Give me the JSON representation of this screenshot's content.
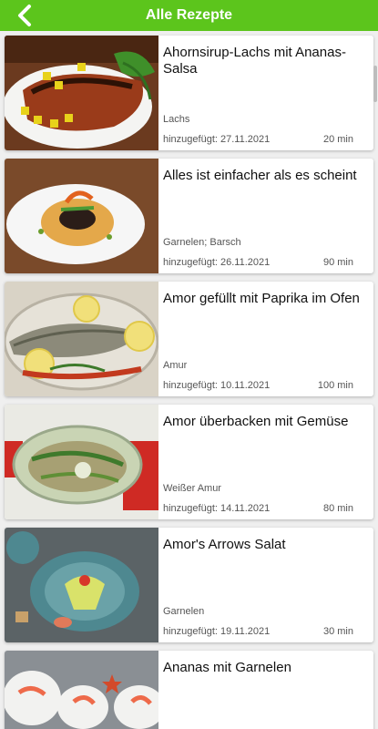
{
  "header": {
    "title": "Alle Rezepte",
    "back_icon": "chevron-left-icon",
    "color": "#5cc51c"
  },
  "recipes": [
    {
      "name": "Ahornsirup-Lachs mit Ananas-Salsa",
      "category": "Lachs",
      "added": "hinzugefügt: 27.11.2021",
      "time": "20 min"
    },
    {
      "name": "Alles ist einfacher als es scheint",
      "category": "Garnelen; Barsch",
      "added": "hinzugefügt: 26.11.2021",
      "time": "90 min"
    },
    {
      "name": "Amor gefüllt mit Paprika im Ofen",
      "category": "Amur",
      "added": "hinzugefügt: 10.11.2021",
      "time": "100 min"
    },
    {
      "name": "Amor überbacken mit Gemüse",
      "category": "Weißer Amur",
      "added": "hinzugefügt: 14.11.2021",
      "time": "80 min"
    },
    {
      "name": "Amor's Arrows Salat",
      "category": "Garnelen",
      "added": "hinzugefügt: 19.11.2021",
      "time": "30 min"
    },
    {
      "name": "Ananas mit Garnelen",
      "category": "",
      "added": "",
      "time": ""
    }
  ]
}
